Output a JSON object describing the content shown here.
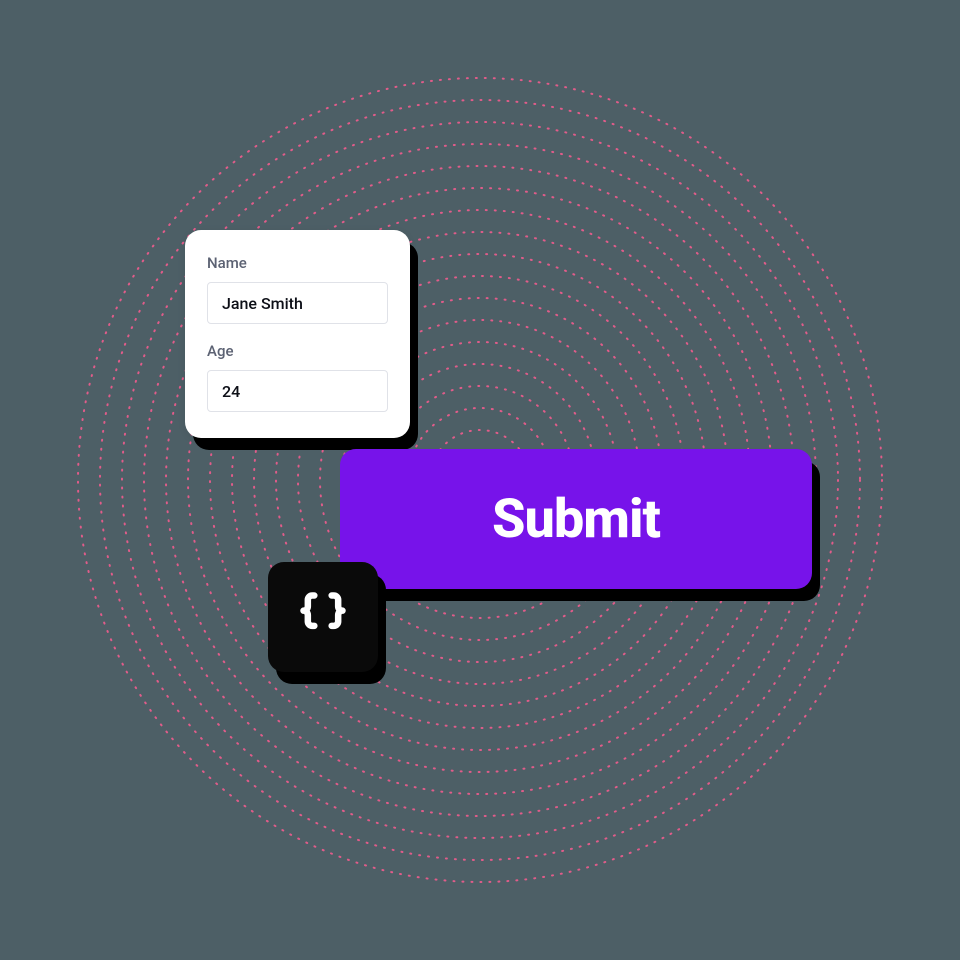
{
  "form": {
    "name_label": "Name",
    "name_value": "Jane Smith",
    "age_label": "Age",
    "age_value": "24"
  },
  "submit_label": "Submit",
  "colors": {
    "submit_bg": "#7713ea",
    "ring_dot": "#e15c8a"
  }
}
